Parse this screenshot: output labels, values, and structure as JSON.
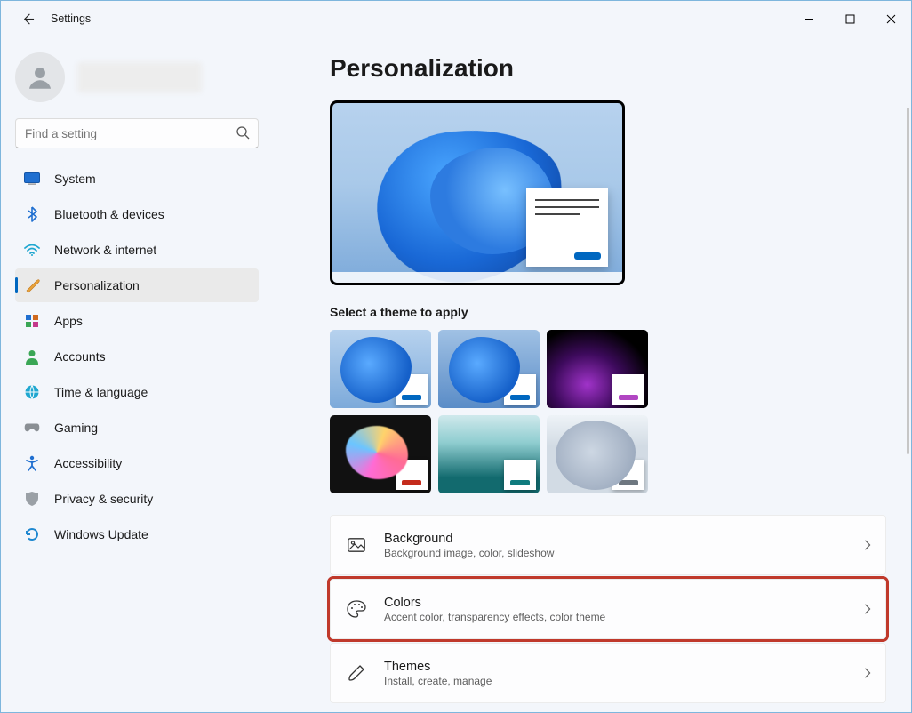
{
  "window": {
    "title": "Settings"
  },
  "user": {
    "name": ""
  },
  "search": {
    "placeholder": "Find a setting"
  },
  "nav": [
    {
      "id": "system",
      "label": "System"
    },
    {
      "id": "bluetooth",
      "label": "Bluetooth & devices"
    },
    {
      "id": "network",
      "label": "Network & internet"
    },
    {
      "id": "personalization",
      "label": "Personalization",
      "selected": true
    },
    {
      "id": "apps",
      "label": "Apps"
    },
    {
      "id": "accounts",
      "label": "Accounts"
    },
    {
      "id": "time",
      "label": "Time & language"
    },
    {
      "id": "gaming",
      "label": "Gaming"
    },
    {
      "id": "accessibility",
      "label": "Accessibility"
    },
    {
      "id": "privacy",
      "label": "Privacy & security"
    },
    {
      "id": "update",
      "label": "Windows Update"
    }
  ],
  "page": {
    "title": "Personalization",
    "theme_section_label": "Select a theme to apply",
    "themes": [
      {
        "id": "bloom-light",
        "accent": "#0067c0"
      },
      {
        "id": "bloom-blue",
        "accent": "#0067c0"
      },
      {
        "id": "glow-dark",
        "accent": "#b146c2"
      },
      {
        "id": "abstract-dark",
        "accent": "#c42b1c"
      },
      {
        "id": "landscape-teal",
        "accent": "#0f7b7e"
      },
      {
        "id": "flow-light",
        "accent": "#6e7780"
      }
    ],
    "rows": {
      "background": {
        "title": "Background",
        "subtitle": "Background image, color, slideshow"
      },
      "colors": {
        "title": "Colors",
        "subtitle": "Accent color, transparency effects, color theme",
        "highlighted": true
      },
      "themes": {
        "title": "Themes",
        "subtitle": "Install, create, manage"
      }
    }
  },
  "colors": {
    "accent": "#0067c0",
    "highlight_box": "#c0392b"
  }
}
